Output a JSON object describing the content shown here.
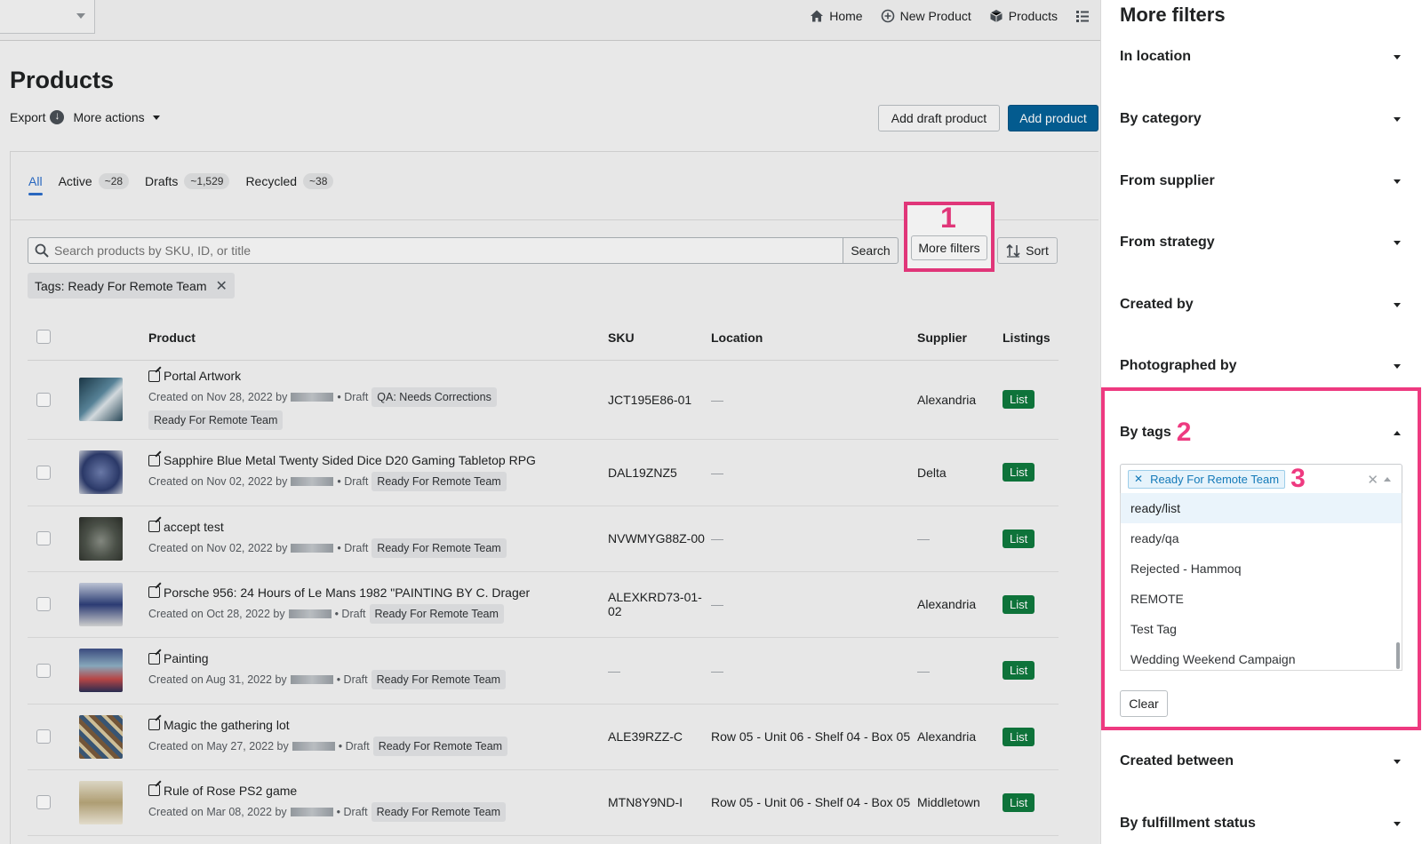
{
  "header": {
    "nav": [
      {
        "label": "Home",
        "icon": "home-icon"
      },
      {
        "label": "New Product",
        "icon": "plus-circle-icon"
      },
      {
        "label": "Products",
        "icon": "box-icon"
      }
    ]
  },
  "page": {
    "title": "Products",
    "export_label": "Export",
    "more_actions_label": "More actions",
    "add_draft_label": "Add draft product",
    "add_product_label": "Add product"
  },
  "tabs": [
    {
      "label": "All",
      "count": ""
    },
    {
      "label": "Active",
      "count": "~28"
    },
    {
      "label": "Drafts",
      "count": "~1,529"
    },
    {
      "label": "Recycled",
      "count": "~38"
    }
  ],
  "search": {
    "placeholder": "Search products by SKU, ID, or title",
    "button_label": "Search",
    "more_filters_label": "More filters",
    "sort_label": "Sort"
  },
  "active_filter": "Tags: Ready For Remote Team",
  "annotations": {
    "one": "1",
    "two": "2",
    "three": "3"
  },
  "table": {
    "headers": {
      "product": "Product",
      "sku": "SKU",
      "location": "Location",
      "supplier": "Supplier",
      "listings": "Listings"
    },
    "rows": [
      {
        "title": "Portal Artwork",
        "created": "Created on Nov 28, 2022 by",
        "status": "• Draft",
        "tags": [
          "QA: Needs Corrections",
          "Ready For Remote Team"
        ],
        "sku": "JCT195E86-01",
        "location": "—",
        "supplier": "Alexandria",
        "listing": "List"
      },
      {
        "title": "Sapphire Blue Metal Twenty Sided Dice D20 Gaming Tabletop RPG",
        "created": "Created on Nov 02, 2022 by",
        "status": "• Draft",
        "tags": [
          "Ready For Remote Team"
        ],
        "sku": "DAL19ZNZ5",
        "location": "—",
        "supplier": "Delta",
        "listing": "List"
      },
      {
        "title": "accept test",
        "created": "Created on Nov 02, 2022 by",
        "status": "• Draft",
        "tags": [
          "Ready For Remote Team"
        ],
        "sku": "NVWMYG88Z-00",
        "location": "—",
        "supplier": "—",
        "listing": "List"
      },
      {
        "title": "Porsche 956: 24 Hours of Le Mans 1982 \"PAINTING BY C. Drager",
        "created": "Created on Oct 28, 2022 by",
        "status": "• Draft",
        "tags": [
          "Ready For Remote Team"
        ],
        "sku": "ALEXKRD73-01-02",
        "location": "—",
        "supplier": "Alexandria",
        "listing": "List"
      },
      {
        "title": "Painting",
        "created": "Created on Aug 31, 2022 by",
        "status": "• Draft",
        "tags": [
          "Ready For Remote Team"
        ],
        "sku": "—",
        "location": "—",
        "supplier": "—",
        "listing": "List"
      },
      {
        "title": "Magic the gathering lot",
        "created": "Created on May 27, 2022 by",
        "status": "• Draft",
        "tags": [
          "Ready For Remote Team"
        ],
        "sku": "ALE39RZZ-C",
        "location": "Row 05 - Unit 06 - Shelf 04 - Box 05",
        "supplier": "Alexandria",
        "listing": "List"
      },
      {
        "title": "Rule of Rose PS2 game",
        "created": "Created on Mar 08, 2022 by",
        "status": "• Draft",
        "tags": [
          "Ready For Remote Team"
        ],
        "sku": "MTN8Y9ND-I",
        "location": "Row 05 - Unit 06 - Shelf 04 - Box 05",
        "supplier": "Middletown",
        "listing": "List"
      }
    ]
  },
  "panel": {
    "title": "More filters",
    "sections": [
      "In location",
      "By category",
      "From supplier",
      "From strategy",
      "Created by",
      "Photographed by"
    ],
    "tags_section": "By tags",
    "selected_tag": "Ready For Remote Team",
    "options": [
      "ready/list",
      "ready/qa",
      "Rejected - Hammoq",
      "REMOTE",
      "Test Tag",
      "Wedding Weekend Campaign"
    ],
    "clear_label": "Clear",
    "bottom_sections": [
      "Created between",
      "By fulfillment status"
    ]
  },
  "colors": {
    "accent": "#2c6ecb",
    "primary_button": "#046198",
    "list_button": "#0f7a3e",
    "highlight": "#ee3a80"
  }
}
